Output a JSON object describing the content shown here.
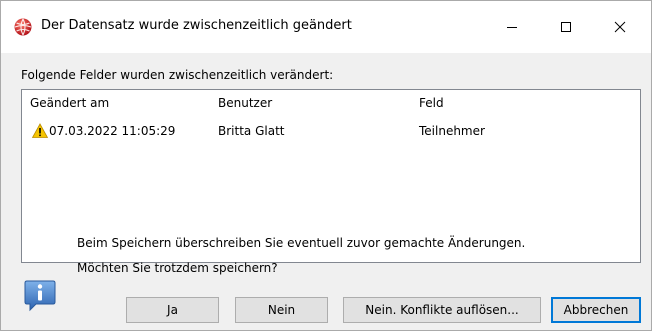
{
  "window": {
    "title": "Der Datensatz wurde zwischenzeitlich geändert",
    "app_icon": "red-sphere-icon",
    "controls": {
      "minimize": "minimize-icon",
      "maximize": "maximize-icon",
      "close": "close-icon"
    }
  },
  "fields_label": "Folgende Felder wurden zwischenzeitlich verändert:",
  "list": {
    "columns": [
      "Geändert am",
      "Benutzer",
      "Feld"
    ],
    "rows": [
      {
        "icon": "warning-icon",
        "changed_at": "07.03.2022 11:05:29",
        "user": "Britta Glatt",
        "field": "Teilnehmer"
      }
    ]
  },
  "message": {
    "icon": "info-icon",
    "line1": "Beim  Speichern überschreiben Sie eventuell zuvor gemachte Änderungen.",
    "line2": "Möchten Sie trotzdem speichern?"
  },
  "buttons": {
    "yes": "Ja",
    "no": "Nein",
    "resolve": "Nein. Konflikte auflösen...",
    "cancel": "Abbrechen"
  },
  "colors": {
    "default_button_border": "#0078d7",
    "warning": "#f5c400",
    "info": "#3a78c3"
  }
}
